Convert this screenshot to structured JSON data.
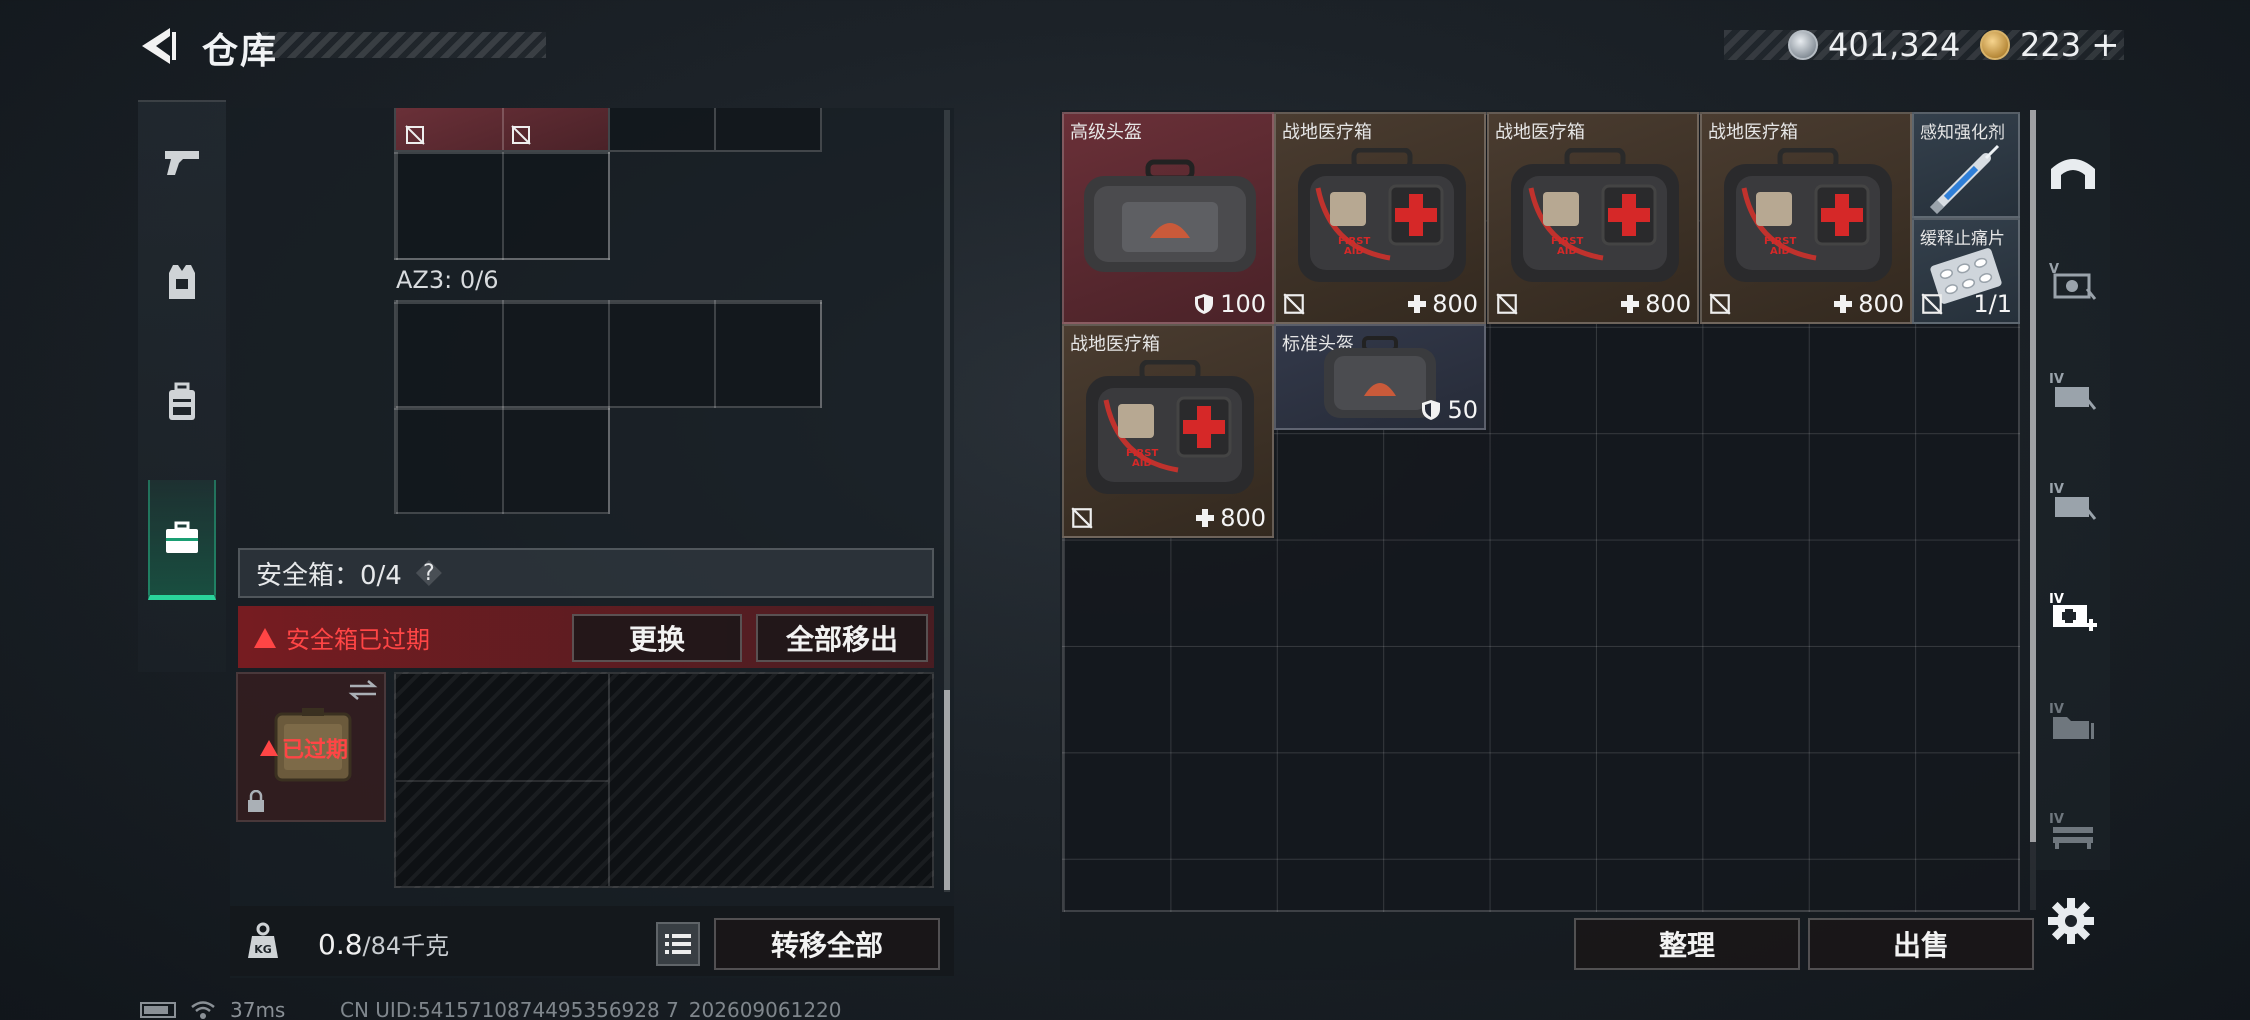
{
  "header": {
    "title": "仓库",
    "silver_amount": "401,324",
    "gold_amount": "223",
    "add_label": "+"
  },
  "left_sidebar": {
    "items": [
      {
        "name": "weapon-tab",
        "icon": "pistol-icon"
      },
      {
        "name": "armor-tab",
        "icon": "vest-icon"
      },
      {
        "name": "backpack-tab",
        "icon": "backpack-icon"
      },
      {
        "name": "safebox-tab",
        "icon": "briefcase-icon",
        "active": true
      }
    ]
  },
  "loadout": {
    "az3_label": "AZ3: 0/6",
    "safebox_label": "安全箱：0/4",
    "help_label": "?",
    "expired_warning": "安全箱已过期",
    "replace_button": "更换",
    "remove_all_button": "全部移出",
    "expired_badge": "已过期",
    "weight_current": "0.8",
    "weight_total": "/84千克",
    "transfer_all_button": "转移全部"
  },
  "stash": {
    "items": [
      {
        "name": "高级头盔",
        "value": "100",
        "value_icon": "shield-icon",
        "bg": "helmet"
      },
      {
        "name": "战地医疗箱",
        "value": "800",
        "value_icon": "plus-icon",
        "bg": "med"
      },
      {
        "name": "战地医疗箱",
        "value": "800",
        "value_icon": "plus-icon",
        "bg": "med"
      },
      {
        "name": "战地医疗箱",
        "value": "800",
        "value_icon": "plus-icon",
        "bg": "med"
      },
      {
        "name": "感知强化剂",
        "value": "",
        "value_icon": "",
        "bg": "blue"
      },
      {
        "name": "缓释止痛片",
        "value": "1/1",
        "value_icon": "",
        "bg": "blue"
      },
      {
        "name": "战地医疗箱",
        "value": "800",
        "value_icon": "plus-icon",
        "bg": "med"
      },
      {
        "name": "标准头盔",
        "value": "50",
        "value_icon": "shield-icon",
        "bg": "std"
      }
    ],
    "sort_button": "整理",
    "sell_button": "出售"
  },
  "right_sidebar": {
    "items": [
      "tent-icon",
      "stash-v-icon",
      "stash-iv-icon",
      "stash-iv-icon",
      "stash-iv-medical-icon",
      "stash-iv-file-icon",
      "stash-iv-rack-icon"
    ]
  },
  "statusbar": {
    "ping": "37ms",
    "uid": "CN UID:5415710874495356928 7_202609061220"
  },
  "colors": {
    "accent_green": "#2ad39b",
    "warning_red": "#ff4545",
    "helmet_bg": "#6a3038",
    "medkit_bg": "#4a3c30"
  }
}
